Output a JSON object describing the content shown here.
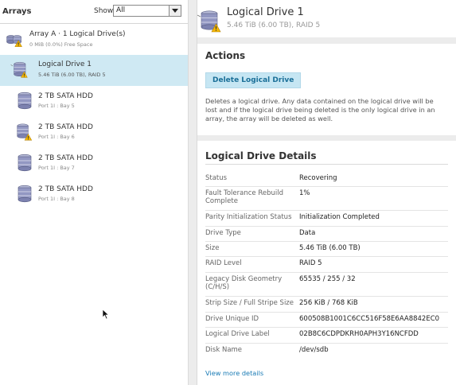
{
  "left": {
    "title": "Arrays",
    "show_label": "Show",
    "show_value": "All",
    "items": [
      {
        "title": "Array A · 1 Logical Drive(s)",
        "subtitle": "0 MiB (0.0%) Free Space",
        "icon": "array-warning-icon"
      },
      {
        "title": "Logical Drive 1",
        "subtitle": "5.46 TiB (6.00 TB), RAID 5",
        "icon": "logical-drive-warning-icon"
      },
      {
        "title": "2 TB SATA HDD",
        "subtitle": "Port 1I : Bay 5",
        "icon": "disk-icon"
      },
      {
        "title": "2 TB SATA HDD",
        "subtitle": "Port 1I : Bay 6",
        "icon": "disk-warning-icon"
      },
      {
        "title": "2 TB SATA HDD",
        "subtitle": "Port 1I : Bay 7",
        "icon": "disk-icon"
      },
      {
        "title": "2 TB SATA HDD",
        "subtitle": "Port 1I : Bay 8",
        "icon": "disk-icon"
      }
    ]
  },
  "header": {
    "title": "Logical Drive 1",
    "subtitle": "5.46 TiB (6.00 TB), RAID 5"
  },
  "actions": {
    "title": "Actions",
    "delete_label": "Delete Logical Drive",
    "delete_desc": "Deletes a logical drive. Any data contained on the logical drive will be lost and if the logical drive being deleted is the only logical drive in an array, the array will be deleted as well."
  },
  "details": {
    "title": "Logical Drive Details",
    "rows": [
      {
        "key": "Status",
        "value": "Recovering"
      },
      {
        "key": "Fault Tolerance Rebuild Complete",
        "value": "1%"
      },
      {
        "key": "Parity Initialization Status",
        "value": "Initialization Completed"
      },
      {
        "key": "Drive Type",
        "value": "Data"
      },
      {
        "key": "Size",
        "value": "5.46 TiB (6.00 TB)"
      },
      {
        "key": "RAID Level",
        "value": "RAID 5"
      },
      {
        "key": "Legacy Disk Geometry (C/H/S)",
        "value": "65535 / 255 / 32"
      },
      {
        "key": "Strip Size / Full Stripe Size",
        "value": "256 KiB / 768 KiB"
      },
      {
        "key": "Drive Unique ID",
        "value": "600508B1001C6CC516F58E6AA8842EC0"
      },
      {
        "key": "Logical Drive Label",
        "value": "02B8C6CDPDKRH0APH3Y16NCFDD"
      },
      {
        "key": "Disk Name",
        "value": "/dev/sdb"
      }
    ],
    "view_more": "View more details"
  },
  "colors": {
    "selected_bg": "#cfe9f3",
    "button_bg": "#c6e6f3",
    "link": "#1a7bb5",
    "warning": "#f5b800"
  }
}
